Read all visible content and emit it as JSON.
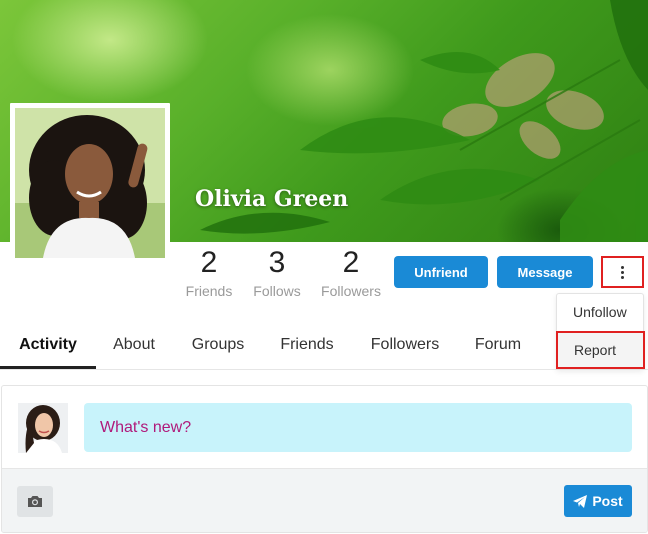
{
  "profile": {
    "name": "Olivia Green"
  },
  "stats": [
    {
      "count": "2",
      "label": "Friends"
    },
    {
      "count": "3",
      "label": "Follows"
    },
    {
      "count": "2",
      "label": "Followers"
    }
  ],
  "actions": {
    "unfriend_label": "Unfriend",
    "message_label": "Message",
    "more_icon": "vertical-ellipsis-icon"
  },
  "dropdown": {
    "items": [
      "Unfollow",
      "Report"
    ]
  },
  "tabs": [
    "Activity",
    "About",
    "Groups",
    "Friends",
    "Followers",
    "Forum"
  ],
  "active_tab": "Activity",
  "composer": {
    "placeholder": "What's new?",
    "camera_icon": "camera-icon",
    "post_label": "Post",
    "post_icon": "paper-plane-icon"
  },
  "colors": {
    "primary_button": "#1a8ad6",
    "highlight_border": "#e02020",
    "input_background": "#c8f3fb",
    "placeholder_text": "#b0197a"
  }
}
